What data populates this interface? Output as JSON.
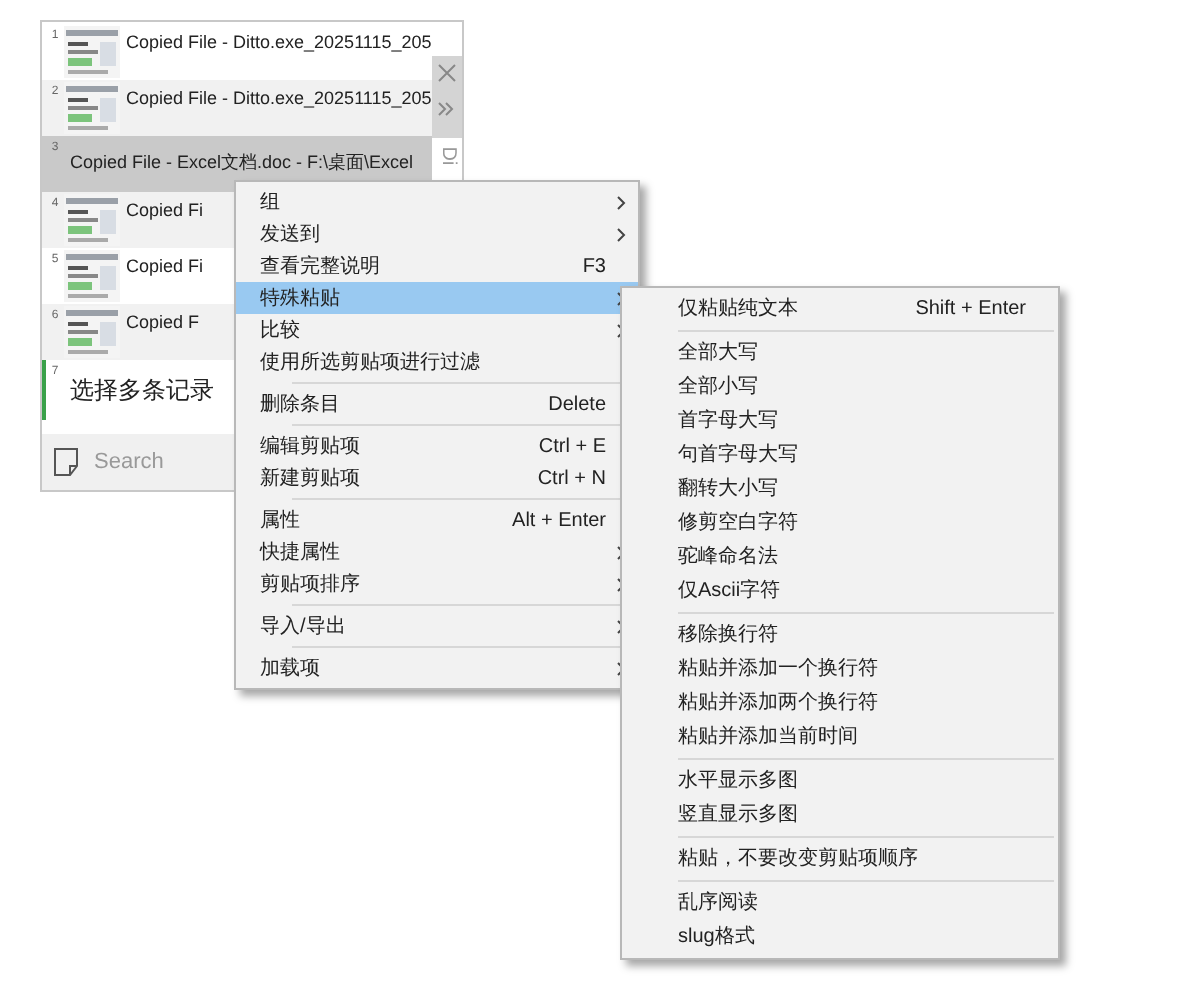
{
  "clips": [
    {
      "number": "1",
      "text": "Copied File - Ditto.exe_20251115_205",
      "selected": false,
      "thumbnail": true
    },
    {
      "number": "2",
      "text": "Copied File - Ditto.exe_20251115_205",
      "selected": false,
      "thumbnail": true
    },
    {
      "number": "3",
      "text": "Copied File - Excel文档.doc - F:\\桌面\\Excel",
      "selected": true,
      "thumbnail": false
    },
    {
      "number": "4",
      "text": "Copied Fi",
      "selected": false,
      "thumbnail": true
    },
    {
      "number": "5",
      "text": "Copied Fi",
      "selected": false,
      "thumbnail": true
    },
    {
      "number": "6",
      "text": "Copied F",
      "selected": false,
      "thumbnail": true
    },
    {
      "number": "7",
      "text": "选择多条记录",
      "selected": false,
      "thumbnail": false
    }
  ],
  "side_label": "Di",
  "search": {
    "placeholder": "Search"
  },
  "context_menu": {
    "sections": [
      [
        {
          "label": "组",
          "submenu": true,
          "selected": false
        },
        {
          "label": "发送到",
          "submenu": true,
          "selected": false
        },
        {
          "label": "查看完整说明",
          "shortcut": "F3",
          "submenu": false,
          "selected": false
        },
        {
          "label": "特殊粘贴",
          "submenu": true,
          "selected": true
        },
        {
          "label": "比较",
          "submenu": true,
          "selected": false
        },
        {
          "label": "使用所选剪贴项进行过滤",
          "submenu": false,
          "selected": false
        }
      ],
      [
        {
          "label": "删除条目",
          "shortcut": "Delete",
          "submenu": false,
          "selected": false
        }
      ],
      [
        {
          "label": "编辑剪贴项",
          "shortcut": "Ctrl + E",
          "submenu": false,
          "selected": false
        },
        {
          "label": "新建剪贴项",
          "shortcut": "Ctrl + N",
          "submenu": false,
          "selected": false
        }
      ],
      [
        {
          "label": "属性",
          "shortcut": "Alt + Enter",
          "submenu": false,
          "selected": false
        },
        {
          "label": "快捷属性",
          "submenu": true,
          "selected": false
        },
        {
          "label": "剪贴项排序",
          "submenu": true,
          "selected": false
        }
      ],
      [
        {
          "label": "导入/导出",
          "submenu": true,
          "selected": false
        }
      ],
      [
        {
          "label": "加载项",
          "submenu": true,
          "selected": false
        }
      ]
    ]
  },
  "submenu": {
    "sections": [
      [
        {
          "label": "仅粘贴纯文本",
          "shortcut": "Shift + Enter"
        }
      ],
      [
        {
          "label": "全部大写"
        },
        {
          "label": "全部小写"
        },
        {
          "label": "首字母大写"
        },
        {
          "label": "句首字母大写"
        },
        {
          "label": "翻转大小写"
        },
        {
          "label": "修剪空白字符"
        },
        {
          "label": "驼峰命名法"
        },
        {
          "label": "仅Ascii字符"
        }
      ],
      [
        {
          "label": "移除换行符"
        },
        {
          "label": "粘贴并添加一个换行符"
        },
        {
          "label": "粘贴并添加两个换行符"
        },
        {
          "label": "粘贴并添加当前时间"
        }
      ],
      [
        {
          "label": "水平显示多图"
        },
        {
          "label": "竖直显示多图"
        }
      ],
      [
        {
          "label": "粘贴，不要改变剪贴项顺序"
        }
      ],
      [
        {
          "label": "乱序阅读"
        },
        {
          "label": "slug格式"
        }
      ]
    ]
  }
}
